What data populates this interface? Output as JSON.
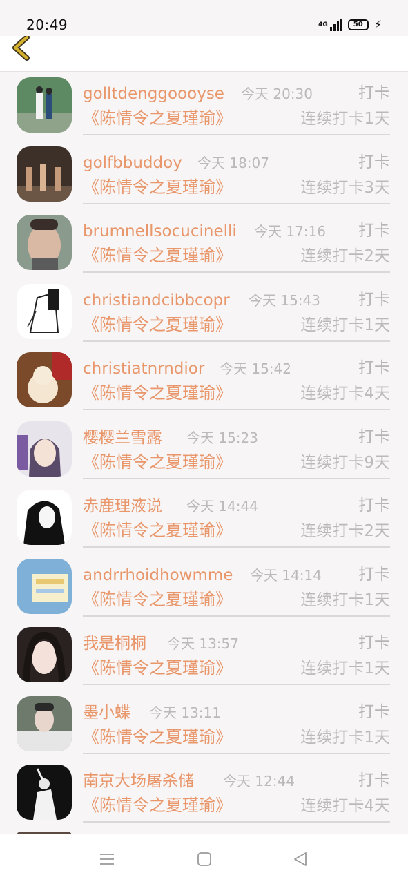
{
  "status_bar": {
    "time": "20:49",
    "network": "4G",
    "battery": "50",
    "icons": [
      "signal-icon",
      "battery-icon",
      "charging-icon"
    ]
  },
  "header": {
    "back_icon": "chevron-left-icon",
    "accent": "#d4b02c"
  },
  "colors": {
    "accent": "#e8966a",
    "muted": "#bdb9ba",
    "background": "#f7f5f6"
  },
  "entries": [
    {
      "name": "golltdenggoooyse",
      "time": "今天 20:30",
      "action": "打卡",
      "book": "《陈情令之夏瑾瑜》",
      "streak": "连续打卡1天"
    },
    {
      "name": "golfbbuddoy",
      "time": "今天 18:07",
      "action": "打卡",
      "book": "《陈情令之夏瑾瑜》",
      "streak": "连续打卡3天"
    },
    {
      "name": "brumnellsocucinelli",
      "time": "今天 17:16",
      "action": "打卡",
      "book": "《陈情令之夏瑾瑜》",
      "streak": "连续打卡2天"
    },
    {
      "name": "christiandcibbcopr",
      "time": "今天 15:43",
      "action": "打卡",
      "book": "《陈情令之夏瑾瑜》",
      "streak": "连续打卡1天"
    },
    {
      "name": "christiatnrndior",
      "time": "今天 15:42",
      "action": "打卡",
      "book": "《陈情令之夏瑾瑜》",
      "streak": "连续打卡4天"
    },
    {
      "name": "樱樱兰雪露",
      "time": "今天 15:23",
      "action": "打卡",
      "book": "《陈情令之夏瑾瑜》",
      "streak": "连续打卡9天"
    },
    {
      "name": "赤鹿理液说",
      "time": "今天 14:44",
      "action": "打卡",
      "book": "《陈情令之夏瑾瑜》",
      "streak": "连续打卡2天"
    },
    {
      "name": "andrrhoidhowmme",
      "time": "今天 14:14",
      "action": "打卡",
      "book": "《陈情令之夏瑾瑜》",
      "streak": "连续打卡1天"
    },
    {
      "name": "我是桐桐",
      "time": "今天 13:57",
      "action": "打卡",
      "book": "《陈情令之夏瑾瑜》",
      "streak": "连续打卡1天"
    },
    {
      "name": "墨小蝶",
      "time": "今天 13:11",
      "action": "打卡",
      "book": "《陈情令之夏瑾瑜》",
      "streak": "连续打卡1天"
    },
    {
      "name": "南京大场屠杀储",
      "time": "今天 12:44",
      "action": "打卡",
      "book": "《陈情令之夏瑾瑜》",
      "streak": "连续打卡4天"
    }
  ],
  "nav_bar": {
    "icons": [
      "menu-icon",
      "home-icon",
      "back-icon"
    ]
  }
}
